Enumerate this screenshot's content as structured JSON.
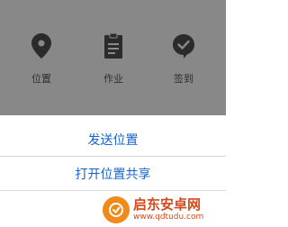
{
  "toolbar": {
    "items": [
      {
        "label": "位置",
        "icon": "location-pin-icon"
      },
      {
        "label": "作业",
        "icon": "clipboard-icon"
      },
      {
        "label": "签到",
        "icon": "check-circle-icon"
      }
    ]
  },
  "action_sheet": {
    "options": [
      {
        "label": "发送位置"
      },
      {
        "label": "打开位置共享"
      }
    ]
  },
  "watermark": {
    "name": "启东安卓网",
    "url": "www.qdtudu.com"
  },
  "colors": {
    "overlay": "#888888",
    "option_text": "#1a63c8",
    "icon": "#2b2b2b",
    "watermark": "#d24a1e",
    "watermark_logo": "#f08a1a"
  }
}
